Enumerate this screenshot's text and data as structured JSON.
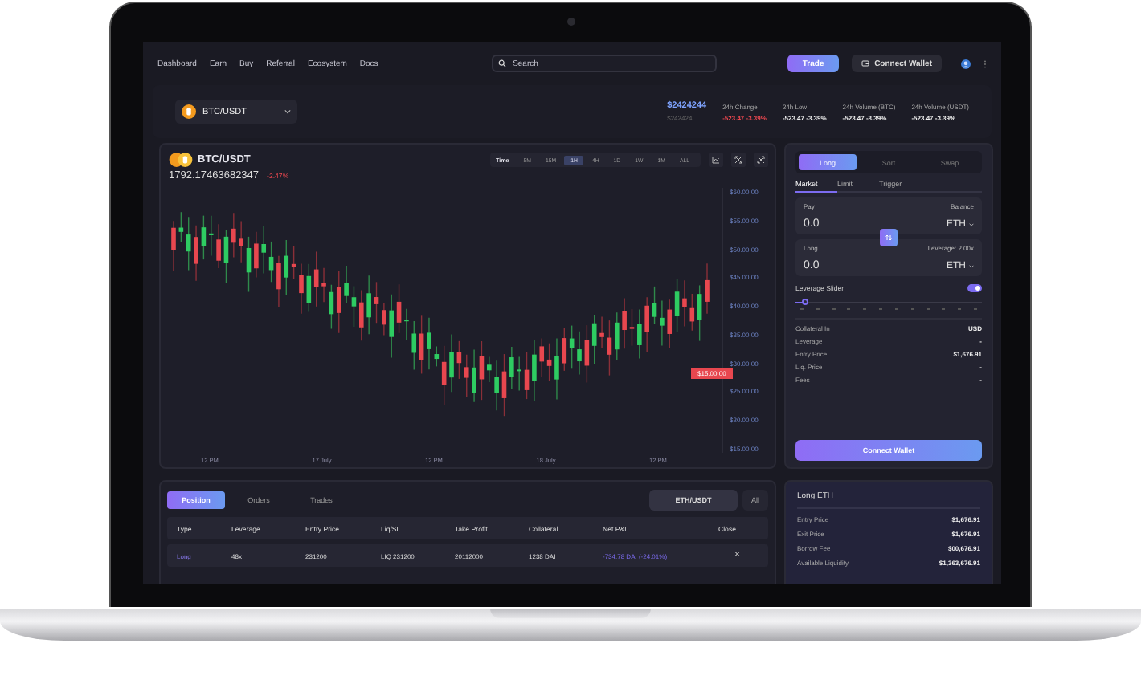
{
  "nav": {
    "links": [
      "Dashboard",
      "Earn",
      "Buy",
      "Referral",
      "Ecosystem",
      "Docs"
    ],
    "search": {
      "placeholder": "Search"
    },
    "trade_button": "Trade",
    "wallet_button": "Connect Wallet"
  },
  "ticker": {
    "pair": "BTC/USDT",
    "price": "$2424244",
    "price_sub": "$242424",
    "stats": [
      {
        "label": "24h Change",
        "value": "-523.47 -3.39%",
        "negative": true
      },
      {
        "label": "24h Low",
        "value": "-523.47 -3.39%",
        "negative": false
      },
      {
        "label": "24h Volume (BTC)",
        "value": "-523.47 -3.39%",
        "negative": false
      },
      {
        "label": "24h Volume (USDT)",
        "value": "-523.47 -3.39%",
        "negative": false
      }
    ]
  },
  "chart": {
    "pair": "BTC/USDT",
    "price": "1792.17463682347",
    "change": "-2.47%",
    "timeframe_label": "Time",
    "timeframes": [
      {
        "label": "5M",
        "selected": false
      },
      {
        "label": "15M",
        "selected": false
      },
      {
        "label": "1H",
        "selected": true
      },
      {
        "label": "4H",
        "selected": false
      },
      {
        "label": "1D",
        "selected": false
      },
      {
        "label": "1W",
        "selected": false
      },
      {
        "label": "1M",
        "selected": false
      },
      {
        "label": "ALL",
        "selected": false
      }
    ],
    "y_labels": [
      "$60.00.00",
      "$55.00.00",
      "$50.00.00",
      "$45.00.00",
      "$40.00.00",
      "$35.00.00",
      "$30.00.00",
      "$25.00.00",
      "$20.00.00",
      "$15.00.00"
    ],
    "x_labels": [
      "12 PM",
      "17 July",
      "12 PM",
      "18 July",
      "12 PM"
    ],
    "current_price": "$15.00.00"
  },
  "trade": {
    "tabs": [
      {
        "label": "Long",
        "selected": true
      },
      {
        "label": "Sort",
        "selected": false
      },
      {
        "label": "Swap",
        "selected": false
      }
    ],
    "order_types": [
      {
        "label": "Market",
        "selected": true
      },
      {
        "label": "Limit",
        "selected": false
      },
      {
        "label": "Trigger",
        "selected": false
      }
    ],
    "pay": {
      "label": "Pay",
      "value": "0.0",
      "right_label": "Balance",
      "token": "ETH"
    },
    "long": {
      "label": "Long",
      "value": "0.0",
      "right_label": "Leverage: 2.00x",
      "token": "ETH"
    },
    "leverage_slider": {
      "label": "Leverage Slider",
      "on": true,
      "level": 0.05
    },
    "details": [
      {
        "label": "Collateral In",
        "value": "USD"
      },
      {
        "label": "Leverage",
        "value": "-"
      },
      {
        "label": "Entry Price",
        "value": "$1,676.91"
      },
      {
        "label": "Liq. Price",
        "value": "-"
      },
      {
        "label": "Fees",
        "value": "-"
      }
    ],
    "button": "Connect Wallet"
  },
  "positions": {
    "tabs": [
      {
        "label": "Position",
        "selected": true
      },
      {
        "label": "Orders",
        "selected": false
      },
      {
        "label": "Trades",
        "selected": false
      }
    ],
    "pair_filter": "ETH/USDT",
    "all_button": "All",
    "columns": [
      "Type",
      "Leverage",
      "Entry Price",
      "Liq/SL",
      "Take Profit",
      "Collateral",
      "Net P&L",
      "Close"
    ],
    "rows": [
      {
        "type": "Long",
        "leverage": "48x",
        "entry_price": "231200",
        "liq_sl": "LIQ 231200",
        "take_profit": "20112000",
        "collateral": "1238 DAI",
        "net_pnl": "-734.78 DAI (-24.01%)",
        "close": "×"
      }
    ]
  },
  "info": {
    "title": "Long ETH",
    "rows": [
      {
        "label": "Entry Price",
        "value": "$1,676.91"
      },
      {
        "label": "Exit Price",
        "value": "$1,676.91"
      },
      {
        "label": "Borrow Fee",
        "value": "$00,676.91"
      },
      {
        "label": "Available Liquidity",
        "value": "$1,363,676.91"
      }
    ]
  }
}
